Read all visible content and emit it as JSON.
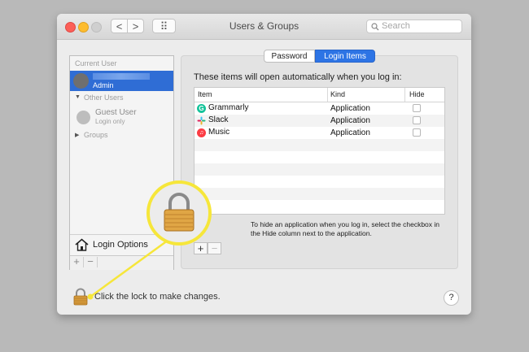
{
  "window": {
    "title": "Users & Groups"
  },
  "toolbar": {
    "back_label": "<",
    "forward_label": ">",
    "grid_label": "⠿",
    "search_placeholder": "Search"
  },
  "sidebar": {
    "current_user_header": "Current User",
    "current_user_role": "Admin",
    "other_users_header": "Other Users",
    "guest_name": "Guest User",
    "guest_sub": "Login only",
    "groups_label": "Groups",
    "login_options_label": "Login Options",
    "add_label": "+",
    "remove_label": "−"
  },
  "tabs": [
    "Password",
    "Login Items"
  ],
  "login_items": {
    "intro": "These items will open automatically when you log in:",
    "columns": [
      "Item",
      "Kind",
      "Hide"
    ],
    "rows": [
      {
        "name": "Grammarly",
        "kind": "Application",
        "icon": "grammarly-icon",
        "color": "#15c39a"
      },
      {
        "name": "Slack",
        "kind": "Application",
        "icon": "slack-icon",
        "color": "#e01e5a"
      },
      {
        "name": "Music",
        "kind": "Application",
        "icon": "music-icon",
        "color": "#fc3c44"
      }
    ],
    "help_text": "To hide an application when you log in, select the checkbox in the Hide column next to the application.",
    "add_label": "+",
    "remove_label": "−"
  },
  "footer": {
    "lock_text": "Click the lock to make changes.",
    "help_label": "?"
  },
  "colors": {
    "accent": "#2d74e5",
    "callout": "#f6e63a"
  }
}
